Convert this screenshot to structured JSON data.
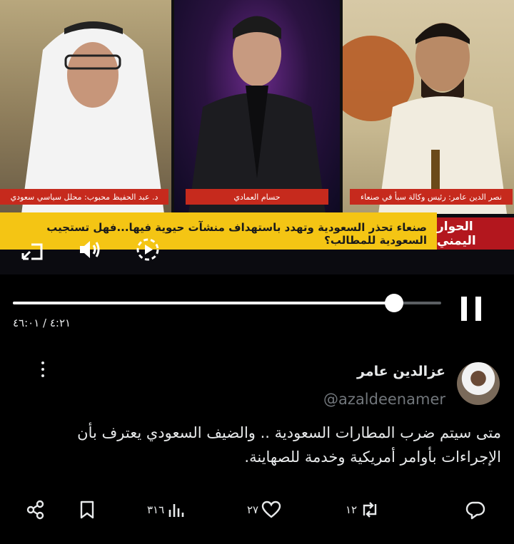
{
  "video": {
    "captions": {
      "right_guest": "د. عبد الحفيظ محبوب: محلل سياسي سعودي",
      "host": "حسام العمادي",
      "left_guest": "نصر الدين عامر: رئيس وكالة سبأ في صنعاء"
    },
    "ticker": "صنعاء تحذر السعودية وتهدد باستهداف منشآت حيوية فيها...فهل تستجيب السعودية للمطالب؟",
    "brand": "الحوار اليمني",
    "progress_fraction": 0.89,
    "time_display": "٤:٢١ / ٤٦:٠١"
  },
  "post": {
    "author_name": "عزالدين عامر",
    "handle": "@azaldeenamer",
    "text": "متى سيتم ضرب المطارات السعودية .. والضيف السعودي يعترف بأن الإجراءات بأوامر أمريكية وخدمة للصهاينة."
  },
  "actions": {
    "replies": "",
    "reposts": "١٢",
    "likes": "٢٧",
    "views": "٣١٦"
  },
  "colors": {
    "background": "#000000",
    "text": "#e7e9ea",
    "muted": "#71767b",
    "ticker": "#f4c514",
    "caption_red": "#c62a1d"
  }
}
